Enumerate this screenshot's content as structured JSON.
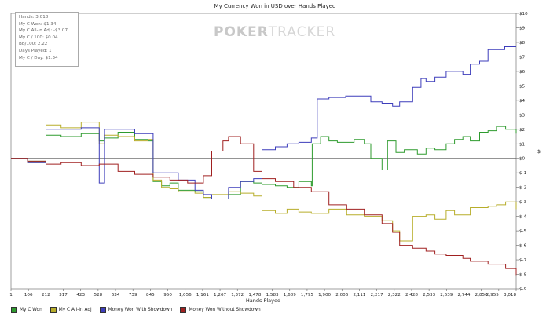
{
  "chart_data": {
    "type": "line",
    "title": "My Currency Won in USD over Hands Played",
    "xlabel": "Hands Played",
    "ylabel": "$",
    "xlim": [
      1,
      3018
    ],
    "ylim": [
      -9,
      10
    ],
    "x_ticks": [
      "1",
      "106",
      "212",
      "317",
      "423",
      "528",
      "634",
      "739",
      "845",
      "950",
      "1,056",
      "1,161",
      "1,267",
      "1,372",
      "1,478",
      "1,583",
      "1,689",
      "1,795",
      "1,900",
      "2,006",
      "2,111",
      "2,217",
      "2,322",
      "2,428",
      "2,533",
      "2,639",
      "2,744",
      "2,850",
      "2,955",
      "3,018"
    ],
    "y_ticks": [
      "$10",
      "$9",
      "$8",
      "$7",
      "$6",
      "$5",
      "$4",
      "$3",
      "$2",
      "$1",
      "$0",
      "$-1",
      "$-2",
      "$-3",
      "$-4",
      "$-5",
      "$-6",
      "$-7",
      "$-8",
      "$-9"
    ],
    "grid": false,
    "legend_position": "bottom-left",
    "stats_box": [
      "Hands: 3,018",
      "My C Won: $1.34",
      "My C All-In Adj: -$3.07",
      "My C / 100: $0.04",
      "BB/100: 2.22",
      "Days Played: 1",
      "My C / Day: $1.34"
    ],
    "watermark": {
      "bold": "POKER",
      "light": "TRACKER"
    },
    "series": [
      {
        "name": "My C Won",
        "color": "#2e9b2e",
        "x": [
          1,
          80,
          100,
          210,
          300,
          420,
          528,
          560,
          640,
          740,
          820,
          850,
          900,
          950,
          1000,
          1100,
          1150,
          1200,
          1300,
          1372,
          1450,
          1500,
          1580,
          1650,
          1720,
          1795,
          1800,
          1850,
          1900,
          1950,
          2050,
          2111,
          2150,
          2217,
          2250,
          2300,
          2350,
          2428,
          2480,
          2533,
          2600,
          2650,
          2700,
          2744,
          2800,
          2850,
          2900,
          2955,
          3018
        ],
        "y": [
          0,
          0,
          -0.2,
          1.6,
          1.5,
          1.7,
          1.2,
          1.4,
          1.8,
          1.3,
          1.2,
          -1.6,
          -1.9,
          -1.7,
          -2.2,
          -2.3,
          -2.7,
          -2.8,
          -2.5,
          -1.6,
          -1.7,
          -1.8,
          -1.9,
          -2.0,
          -1.6,
          -1.9,
          1.0,
          1.5,
          1.2,
          1.1,
          1.3,
          1.0,
          0.0,
          -0.8,
          1.2,
          0.4,
          0.6,
          0.3,
          0.7,
          0.6,
          1.0,
          1.3,
          1.5,
          1.2,
          1.8,
          1.9,
          2.2,
          2.0,
          1.7
        ]
      },
      {
        "name": "My C All-In Adj",
        "color": "#b7ad2a",
        "x": [
          1,
          80,
          100,
          210,
          300,
          420,
          528,
          560,
          640,
          740,
          820,
          850,
          900,
          950,
          1000,
          1100,
          1150,
          1200,
          1300,
          1372,
          1450,
          1500,
          1580,
          1650,
          1720,
          1795,
          1900,
          2006,
          2111,
          2217,
          2280,
          2322,
          2400,
          2480,
          2533,
          2600,
          2650,
          2744,
          2850,
          2900,
          2955,
          3018
        ],
        "y": [
          0,
          0,
          -0.3,
          2.3,
          2.1,
          2.5,
          1.0,
          1.6,
          1.5,
          1.2,
          1.3,
          -1.5,
          -2.0,
          -2.1,
          -2.3,
          -2.4,
          -2.7,
          -2.5,
          -2.3,
          -2.4,
          -2.6,
          -3.6,
          -3.8,
          -3.5,
          -3.7,
          -3.8,
          -3.5,
          -3.9,
          -4.0,
          -4.3,
          -5.0,
          -5.7,
          -4.0,
          -3.9,
          -4.2,
          -3.6,
          -3.9,
          -3.4,
          -3.3,
          -3.2,
          -3.0,
          -3.5
        ]
      },
      {
        "name": "Money Won With Showdown",
        "color": "#3d3dbb",
        "x": [
          1,
          100,
          210,
          420,
          528,
          560,
          740,
          850,
          1000,
          1100,
          1150,
          1200,
          1300,
          1372,
          1450,
          1500,
          1580,
          1650,
          1720,
          1795,
          1830,
          1900,
          2000,
          2150,
          2217,
          2280,
          2322,
          2400,
          2450,
          2480,
          2533,
          2600,
          2700,
          2744,
          2800,
          2850,
          2950,
          3018
        ],
        "y": [
          0,
          -0.3,
          2.0,
          2.1,
          -1.7,
          2.0,
          1.7,
          -1.0,
          -1.5,
          -2.2,
          -2.5,
          -2.8,
          -2.0,
          -1.6,
          -1.4,
          0.6,
          0.8,
          1.0,
          1.1,
          1.4,
          4.1,
          4.2,
          4.3,
          3.9,
          3.8,
          3.6,
          3.9,
          4.9,
          5.5,
          5.3,
          5.6,
          6.0,
          5.8,
          6.5,
          6.7,
          7.5,
          7.7,
          7.7
        ]
      },
      {
        "name": "Money Won Without Showdown",
        "color": "#a02020",
        "x": [
          1,
          100,
          210,
          300,
          420,
          528,
          640,
          740,
          850,
          950,
          1056,
          1150,
          1200,
          1267,
          1300,
          1372,
          1450,
          1500,
          1580,
          1689,
          1795,
          1900,
          2006,
          2111,
          2217,
          2280,
          2322,
          2400,
          2480,
          2533,
          2600,
          2700,
          2744,
          2850,
          2955,
          3018
        ],
        "y": [
          0,
          -0.2,
          -0.4,
          -0.3,
          -0.5,
          -0.4,
          -0.9,
          -1.1,
          -1.3,
          -1.5,
          -1.7,
          -1.2,
          0.5,
          1.2,
          1.5,
          1.0,
          -0.9,
          -1.4,
          -1.6,
          -2.0,
          -2.3,
          -3.2,
          -3.5,
          -3.9,
          -4.5,
          -5.1,
          -6.0,
          -6.2,
          -6.4,
          -6.6,
          -6.7,
          -6.9,
          -7.1,
          -7.3,
          -7.6,
          -8.1
        ]
      }
    ]
  }
}
